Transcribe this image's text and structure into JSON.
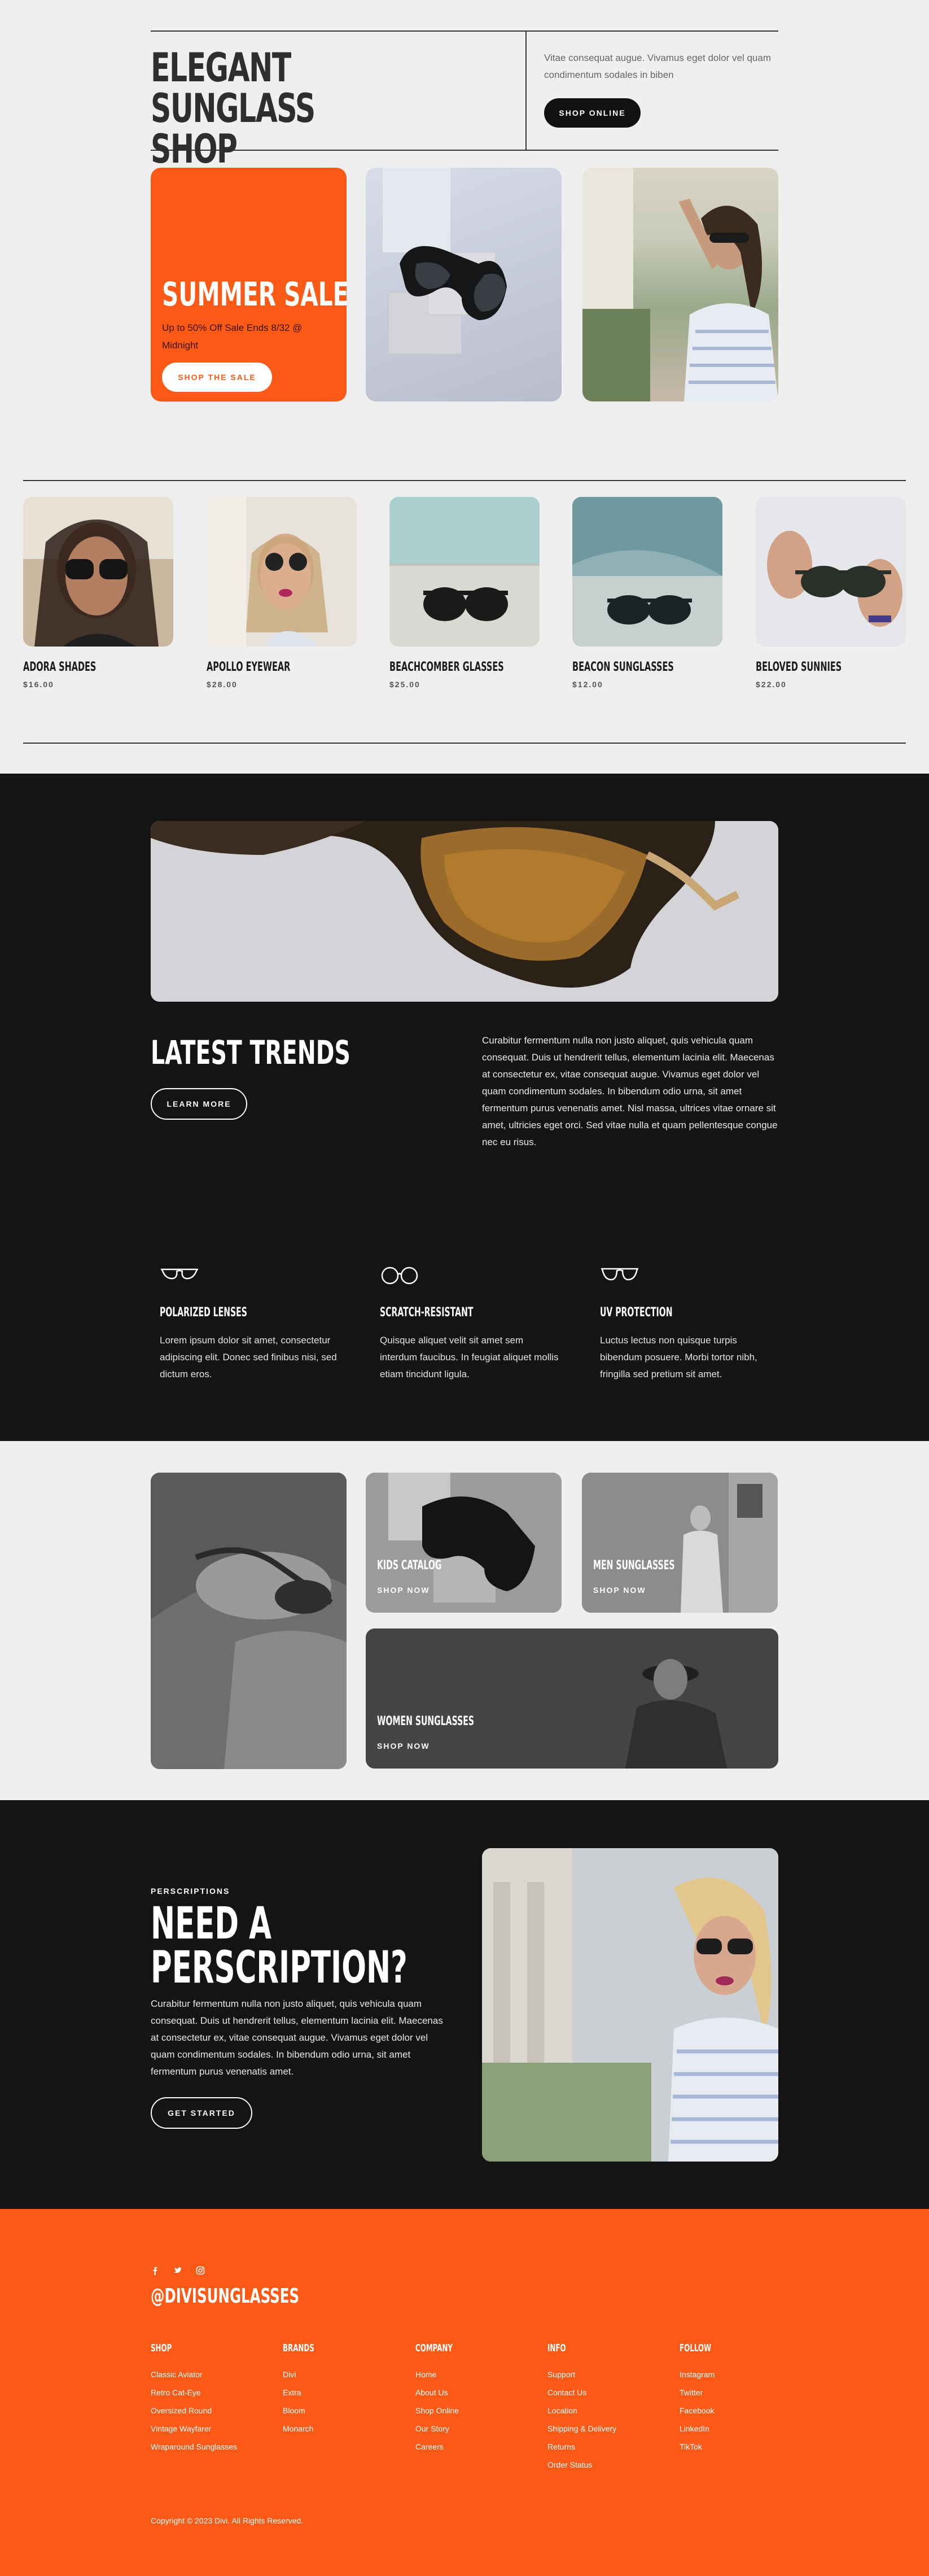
{
  "hero": {
    "title": "ELEGANT SUNGLASS SHOP",
    "intro": "Vitae consequat augue. Vivamus eget dolor vel quam condimentum sodales in biben",
    "shop_online": "SHOP ONLINE",
    "sale_title": "SUMMER SALE",
    "sale_sub": "Up to 50% Off Sale Ends 8/32 @ Midnight",
    "sale_button": "SHOP THE SALE"
  },
  "products": [
    {
      "name": "ADORA SHADES",
      "price": "$16.00"
    },
    {
      "name": "APOLLO EYEWEAR",
      "price": "$28.00"
    },
    {
      "name": "BEACHCOMBER GLASSES",
      "price": "$25.00"
    },
    {
      "name": "BEACON SUNGLASSES",
      "price": "$12.00"
    },
    {
      "name": "BELOVED SUNNIES",
      "price": "$22.00"
    }
  ],
  "trends": {
    "title": "LATEST TRENDS",
    "button": "LEARN MORE",
    "description": "Curabitur fermentum nulla non justo aliquet, quis vehicula quam consequat. Duis ut hendrerit tellus, elementum lacinia elit. Maecenas at consectetur ex, vitae consequat augue. Vivamus eget dolor vel quam condimentum sodales. In bibendum odio urna, sit amet fermentum purus venenatis amet. Nisl massa, ultrices vitae ornare sit amet, ultricies eget orci. Sed vitae nulla et quam pellentesque congue nec eu risus."
  },
  "features": [
    {
      "title": "POLARIZED LENSES",
      "text": "Lorem ipsum dolor sit amet, consectetur adipiscing elit. Donec sed finibus nisi, sed dictum eros."
    },
    {
      "title": "SCRATCH-RESISTANT",
      "text": "Quisque aliquet velit sit amet sem interdum faucibus. In feugiat aliquet mollis etiam tincidunt ligula."
    },
    {
      "title": "UV PROTECTION",
      "text": "Luctus lectus non quisque turpis bibendum posuere. Morbi tortor nibh, fringilla sed pretium sit amet."
    }
  ],
  "categories": {
    "kids": "KIDS CATALOG",
    "men": "MEN SUNGLASSES",
    "women": "WOMEN SUNGLASSES",
    "shop_now": "SHOP NOW"
  },
  "prescription": {
    "eyebrow": "PERSCRIPTIONS",
    "title": "NEED A PERSCRIPTION?",
    "text": "Curabitur fermentum nulla non justo aliquet, quis vehicula quam consequat. Duis ut hendrerit tellus, elementum lacinia elit. Maecenas at consectetur ex, vitae consequat augue. Vivamus eget dolor vel quam condimentum sodales. In bibendum odio urna, sit amet fermentum purus venenatis amet.",
    "button": "GET STARTED"
  },
  "footer": {
    "handle": "@DIVISUNGLASSES",
    "social_icons": [
      "facebook-icon",
      "twitter-icon",
      "instagram-icon"
    ],
    "columns": [
      {
        "heading": "SHOP",
        "items": [
          "Classic Aviator",
          "Retro Cat-Eye",
          "Oversized Round",
          "Vintage Wayfarer",
          "Wraparound Sunglasses"
        ]
      },
      {
        "heading": "BRANDS",
        "items": [
          "Divi",
          "Extra",
          "Bloom",
          "Monarch"
        ]
      },
      {
        "heading": "COMPANY",
        "items": [
          "Home",
          "About Us",
          "Shop Online",
          "Our Story",
          "Careers"
        ]
      },
      {
        "heading": "INFO",
        "items": [
          "Support",
          "Contact Us",
          "Location",
          "Shipping & Delivery",
          "Returns",
          "Order Status"
        ]
      },
      {
        "heading": "FOLLOW",
        "items": [
          "Instagram",
          "Twitter",
          "Facebook",
          "LinkedIn",
          "TikTok"
        ]
      }
    ],
    "copyright": "Copyright © 2023 Divi. All Rights Reserved."
  },
  "colors": {
    "accent": "#fb5a16",
    "dark": "#141414",
    "light": "#efefef"
  }
}
